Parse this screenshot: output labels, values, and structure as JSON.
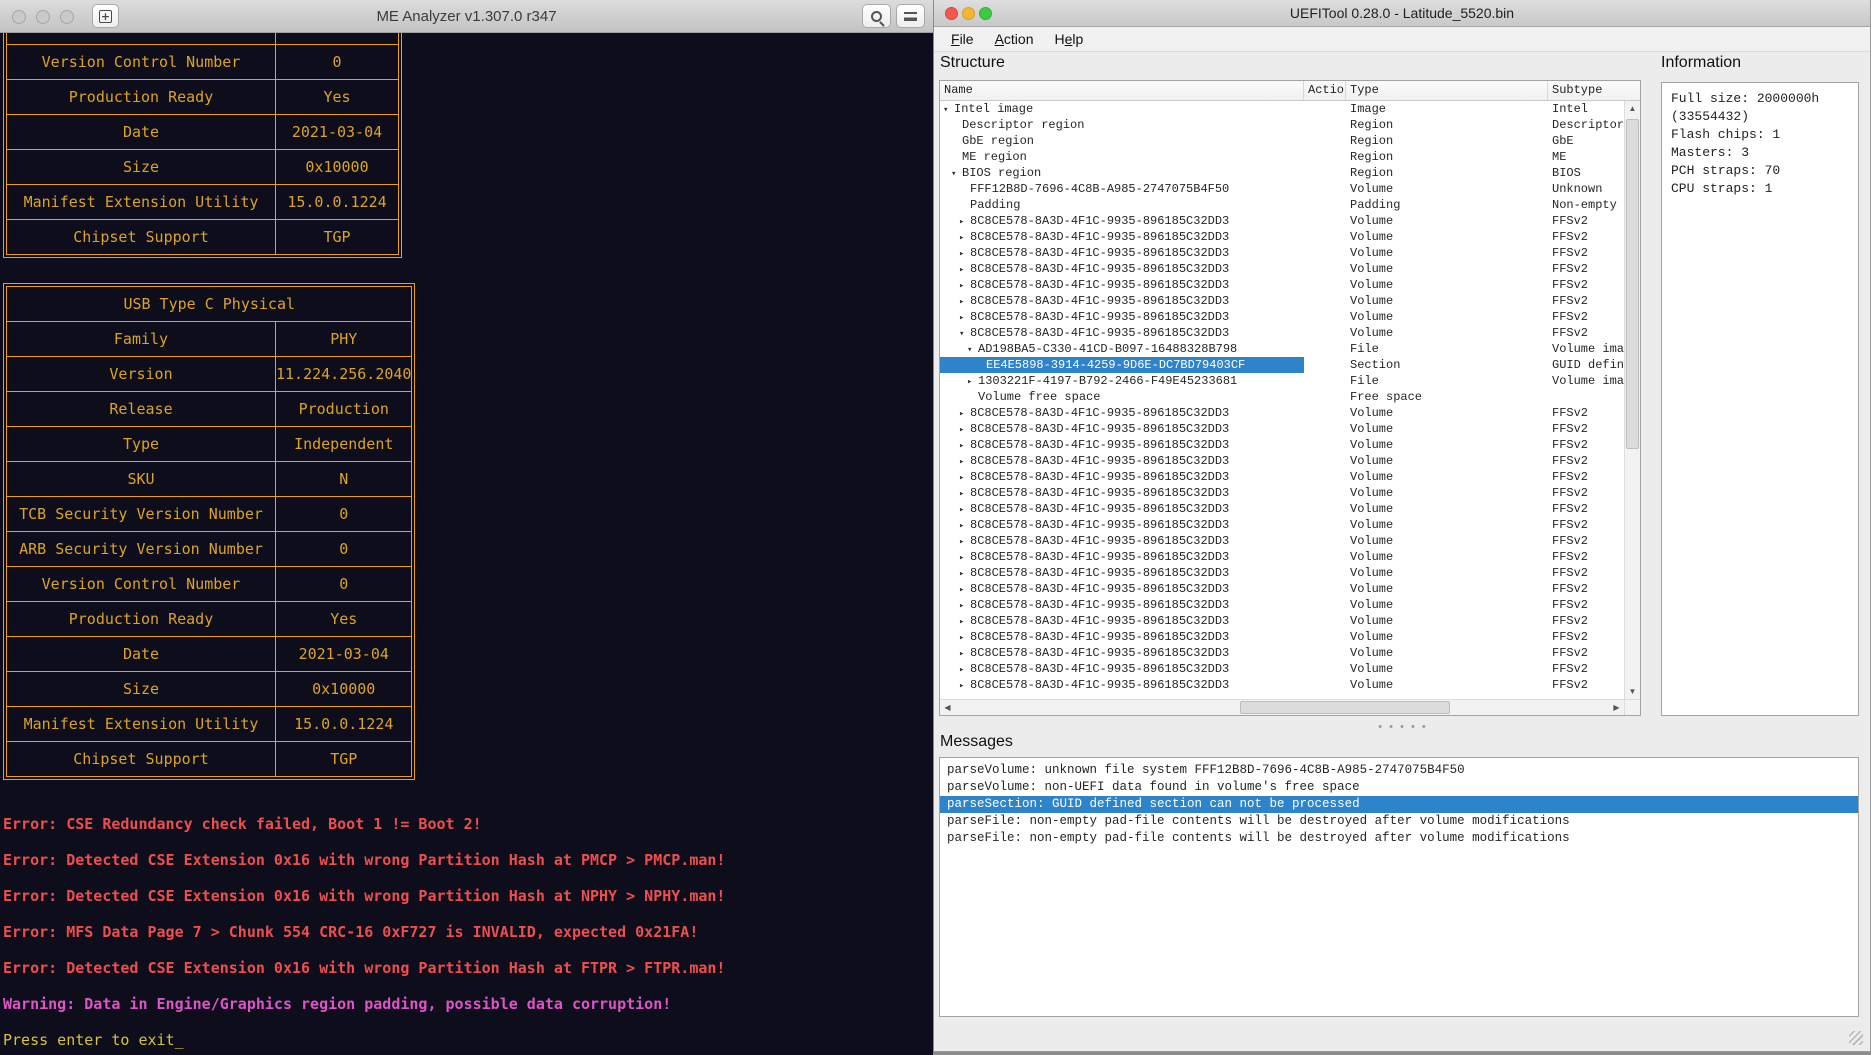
{
  "colors": {
    "terminal_bg": "#0d0d1c",
    "table_border": "#f2a007",
    "table_text": "#dca327",
    "error_text": "#ef4e4e",
    "warning_text": "#df54c6",
    "prompt_text": "#d8c33c",
    "selection_blue": "#2e84cb",
    "chrome_gray": "#ececec",
    "traffic_red": "#f4574e",
    "traffic_yellow": "#f3b632",
    "traffic_green": "#3fc943"
  },
  "terminal": {
    "titlebar": {
      "title": "ME Analyzer v1.307.0 r347",
      "newtab_glyph": "+",
      "icons": [
        "window-button",
        "window-button",
        "window-button",
        "new-tab",
        "search",
        "menu"
      ]
    },
    "table1": {
      "rows": [
        [
          "Version Control Number",
          "0"
        ],
        [
          "Production Ready",
          "Yes"
        ],
        [
          "Date",
          "2021-03-04"
        ],
        [
          "Size",
          "0x10000"
        ],
        [
          "Manifest Extension Utility",
          "15.0.0.1224"
        ],
        [
          "Chipset Support",
          "TGP"
        ]
      ]
    },
    "table2": {
      "header": "USB Type C Physical",
      "rows": [
        [
          "Family",
          "PHY"
        ],
        [
          "Version",
          "11.224.256.2040"
        ],
        [
          "Release",
          "Production"
        ],
        [
          "Type",
          "Independent"
        ],
        [
          "SKU",
          "N"
        ],
        [
          "TCB Security Version Number",
          "0"
        ],
        [
          "ARB Security Version Number",
          "0"
        ],
        [
          "Version Control Number",
          "0"
        ],
        [
          "Production Ready",
          "Yes"
        ],
        [
          "Date",
          "2021-03-04"
        ],
        [
          "Size",
          "0x10000"
        ],
        [
          "Manifest Extension Utility",
          "15.0.0.1224"
        ],
        [
          "Chipset Support",
          "TGP"
        ]
      ]
    },
    "output_lines": [
      {
        "kind": "error",
        "text": "Error: CSE Redundancy check failed, Boot 1 != Boot 2!"
      },
      {
        "kind": "error",
        "text": "Error: Detected CSE Extension 0x16 with wrong Partition Hash at PMCP > PMCP.man!"
      },
      {
        "kind": "error",
        "text": "Error: Detected CSE Extension 0x16 with wrong Partition Hash at NPHY > NPHY.man!"
      },
      {
        "kind": "error",
        "text": "Error: MFS Data Page 7 > Chunk 554 CRC-16 0xF727 is INVALID, expected 0x21FA!"
      },
      {
        "kind": "error",
        "text": "Error: Detected CSE Extension 0x16 with wrong Partition Hash at FTPR > FTPR.man!"
      },
      {
        "kind": "warning",
        "text": "Warning: Data in Engine/Graphics region padding, possible data corruption!"
      },
      {
        "kind": "prompt",
        "text": "Press enter to exit",
        "cursor": "_"
      }
    ]
  },
  "uefitool": {
    "title": "UEFITool 0.28.0 - Latitude_5520.bin",
    "menu": [
      {
        "label": "File",
        "underline": 0
      },
      {
        "label": "Action",
        "underline": 0
      },
      {
        "label": "Help",
        "underline": 1
      }
    ],
    "structure": {
      "label": "Structure",
      "columns": [
        "Name",
        "Action",
        "Type",
        "Subtype"
      ],
      "row_format": [
        "indent",
        "arrow(v=expanded,r=collapsed)",
        "name",
        "type",
        "subtype",
        "selected"
      ],
      "rows": [
        [
          0,
          "v",
          "Intel image",
          "Image",
          "Intel",
          0
        ],
        [
          1,
          "",
          "Descriptor region",
          "Region",
          "Descriptor",
          0
        ],
        [
          1,
          "",
          "GbE region",
          "Region",
          "GbE",
          0
        ],
        [
          1,
          "",
          "ME region",
          "Region",
          "ME",
          0
        ],
        [
          1,
          "v",
          "BIOS region",
          "Region",
          "BIOS",
          0
        ],
        [
          2,
          "",
          "FFF12B8D-7696-4C8B-A985-2747075B4F50",
          "Volume",
          "Unknown",
          0
        ],
        [
          2,
          "",
          "Padding",
          "Padding",
          "Non-empty",
          0
        ],
        [
          2,
          "r",
          "8C8CE578-8A3D-4F1C-9935-896185C32DD3",
          "Volume",
          "FFSv2",
          0
        ],
        [
          2,
          "r",
          "8C8CE578-8A3D-4F1C-9935-896185C32DD3",
          "Volume",
          "FFSv2",
          0
        ],
        [
          2,
          "r",
          "8C8CE578-8A3D-4F1C-9935-896185C32DD3",
          "Volume",
          "FFSv2",
          0
        ],
        [
          2,
          "r",
          "8C8CE578-8A3D-4F1C-9935-896185C32DD3",
          "Volume",
          "FFSv2",
          0
        ],
        [
          2,
          "r",
          "8C8CE578-8A3D-4F1C-9935-896185C32DD3",
          "Volume",
          "FFSv2",
          0
        ],
        [
          2,
          "r",
          "8C8CE578-8A3D-4F1C-9935-896185C32DD3",
          "Volume",
          "FFSv2",
          0
        ],
        [
          2,
          "r",
          "8C8CE578-8A3D-4F1C-9935-896185C32DD3",
          "Volume",
          "FFSv2",
          0
        ],
        [
          2,
          "v",
          "8C8CE578-8A3D-4F1C-9935-896185C32DD3",
          "Volume",
          "FFSv2",
          0
        ],
        [
          3,
          "v",
          "AD198BA5-C330-41CD-B097-16488328B798",
          "File",
          "Volume image",
          0
        ],
        [
          4,
          "",
          "EE4E5898-3914-4259-9D6E-DC7BD79403CF",
          "Section",
          "GUID defined",
          1
        ],
        [
          3,
          "r",
          "1303221F-4197-B792-2466-F49E45233681",
          "File",
          "Volume image",
          0
        ],
        [
          3,
          "",
          "Volume free space",
          "Free space",
          "",
          0
        ],
        [
          2,
          "r",
          "8C8CE578-8A3D-4F1C-9935-896185C32DD3",
          "Volume",
          "FFSv2",
          0
        ],
        [
          2,
          "r",
          "8C8CE578-8A3D-4F1C-9935-896185C32DD3",
          "Volume",
          "FFSv2",
          0
        ],
        [
          2,
          "r",
          "8C8CE578-8A3D-4F1C-9935-896185C32DD3",
          "Volume",
          "FFSv2",
          0
        ],
        [
          2,
          "r",
          "8C8CE578-8A3D-4F1C-9935-896185C32DD3",
          "Volume",
          "FFSv2",
          0
        ],
        [
          2,
          "r",
          "8C8CE578-8A3D-4F1C-9935-896185C32DD3",
          "Volume",
          "FFSv2",
          0
        ],
        [
          2,
          "r",
          "8C8CE578-8A3D-4F1C-9935-896185C32DD3",
          "Volume",
          "FFSv2",
          0
        ],
        [
          2,
          "r",
          "8C8CE578-8A3D-4F1C-9935-896185C32DD3",
          "Volume",
          "FFSv2",
          0
        ],
        [
          2,
          "r",
          "8C8CE578-8A3D-4F1C-9935-896185C32DD3",
          "Volume",
          "FFSv2",
          0
        ],
        [
          2,
          "r",
          "8C8CE578-8A3D-4F1C-9935-896185C32DD3",
          "Volume",
          "FFSv2",
          0
        ],
        [
          2,
          "r",
          "8C8CE578-8A3D-4F1C-9935-896185C32DD3",
          "Volume",
          "FFSv2",
          0
        ],
        [
          2,
          "r",
          "8C8CE578-8A3D-4F1C-9935-896185C32DD3",
          "Volume",
          "FFSv2",
          0
        ],
        [
          2,
          "r",
          "8C8CE578-8A3D-4F1C-9935-896185C32DD3",
          "Volume",
          "FFSv2",
          0
        ],
        [
          2,
          "r",
          "8C8CE578-8A3D-4F1C-9935-896185C32DD3",
          "Volume",
          "FFSv2",
          0
        ],
        [
          2,
          "r",
          "8C8CE578-8A3D-4F1C-9935-896185C32DD3",
          "Volume",
          "FFSv2",
          0
        ],
        [
          2,
          "r",
          "8C8CE578-8A3D-4F1C-9935-896185C32DD3",
          "Volume",
          "FFSv2",
          0
        ],
        [
          2,
          "r",
          "8C8CE578-8A3D-4F1C-9935-896185C32DD3",
          "Volume",
          "FFSv2",
          0
        ],
        [
          2,
          "r",
          "8C8CE578-8A3D-4F1C-9935-896185C32DD3",
          "Volume",
          "FFSv2",
          0
        ],
        [
          2,
          "r",
          "8C8CE578-8A3D-4F1C-9935-896185C32DD3",
          "Volume",
          "FFSv2",
          0
        ]
      ]
    },
    "information": {
      "label": "Information",
      "lines": [
        "Full size: 2000000h",
        "(33554432)",
        "Flash chips: 1",
        "Masters: 3",
        "PCH straps: 70",
        "CPU straps: 1"
      ]
    },
    "messages": {
      "label": "Messages",
      "lines": [
        {
          "text": "parseVolume: unknown file system FFF12B8D-7696-4C8B-A985-2747075B4F50",
          "selected": 0
        },
        {
          "text": "parseVolume: non-UEFI data found in volume's free space",
          "selected": 0
        },
        {
          "text": "parseSection: GUID defined section can not be processed",
          "selected": 1
        },
        {
          "text": "parseFile: non-empty pad-file contents will be destroyed after volume modifications",
          "selected": 0
        },
        {
          "text": "parseFile: non-empty pad-file contents will be destroyed after volume modifications",
          "selected": 0
        }
      ]
    }
  }
}
